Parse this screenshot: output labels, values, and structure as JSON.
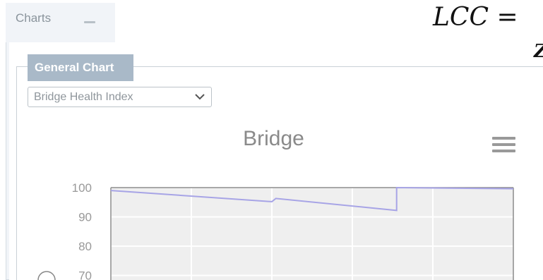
{
  "panel": {
    "title": "Charts"
  },
  "formula": {
    "text": "LCC =",
    "overflow_glyph": "Z"
  },
  "group": {
    "legend": "General Chart",
    "select_value": "Bridge Health Index"
  },
  "chart_data": {
    "type": "line",
    "title": "Bridge",
    "xlabel": "",
    "ylabel": "",
    "y_ticks": [
      "100",
      "90",
      "80",
      "70"
    ],
    "ylim": [
      68,
      100
    ],
    "grid": true,
    "x": [
      0,
      2,
      2.05,
      3.55,
      3.55,
      5.0
    ],
    "series": [
      {
        "values": [
          99.0,
          95.2,
          96.3,
          92.2,
          100.0,
          99.6
        ]
      }
    ],
    "series_color": "#a7a4e6",
    "xlim": [
      0,
      5
    ],
    "x_gridlines": [
      0,
      1,
      2,
      3,
      4
    ]
  },
  "colors": {
    "legend_bg": "#a9b9c8",
    "plot_bg": "#efefef",
    "series": "#a7a4e6"
  }
}
